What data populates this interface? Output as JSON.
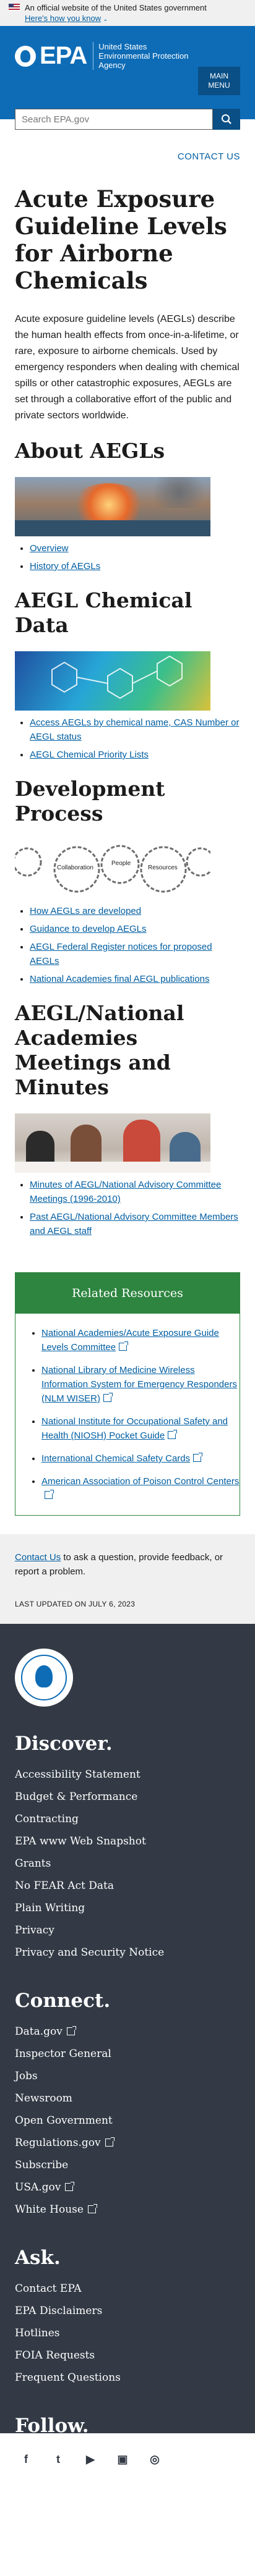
{
  "banner": {
    "official": "An official website of the United States government",
    "how_know": "Here's how you know"
  },
  "header": {
    "logo_text": "EPA",
    "agency": "United States Environmental Protection Agency",
    "menu": "MAIN MENU",
    "search_placeholder": "Search EPA.gov"
  },
  "contact_top": "CONTACT US",
  "page": {
    "title": "Acute Exposure Guideline Levels for Airborne Chemicals",
    "intro": "Acute exposure guideline levels (AEGLs) describe the human health effects from once-in-a-lifetime, or rare, exposure to airborne chemicals. Used by emergency responders when dealing with chemical spills or other catastrophic exposures, AEGLs are set through a collaborative effort of the public and private sectors worldwide."
  },
  "sections": [
    {
      "heading": "About AEGLs",
      "links": [
        "Overview",
        "History of AEGLs"
      ]
    },
    {
      "heading": "AEGL Chemical Data",
      "links": [
        "Access AEGLs by chemical name, CAS Number or AEGL status",
        "AEGL Chemical Priority Lists"
      ]
    },
    {
      "heading": "Development Process",
      "gear_labels": [
        "Collaboration",
        "People",
        "Resources"
      ],
      "links": [
        "How AEGLs are developed",
        "Guidance to develop AEGLs",
        "AEGL Federal Register notices for proposed AEGLs",
        "National Academies final AEGL publications"
      ]
    },
    {
      "heading": "AEGL/National Academies Meetings and Minutes",
      "links": [
        "Minutes of AEGL/National Advisory Committee Meetings (1996-2010)",
        "Past AEGL/National Advisory Committee Members and AEGL staff"
      ]
    }
  ],
  "related": {
    "heading": "Related Resources",
    "links": [
      "National Academies/Acute Exposure Guide Levels Committee",
      "National Library of Medicine Wireless Information System for Emergency Responders (NLM WISER)",
      "National Institute for Occupational Safety and Health (NIOSH) Pocket Guide",
      "International Chemical Safety Cards",
      "American Association of Poison Control Centers"
    ]
  },
  "contact_band": {
    "link": "Contact Us",
    "text": " to ask a question, provide feedback, or report a problem.",
    "updated": "LAST UPDATED ON JULY 6, 2023"
  },
  "footer": {
    "discover": {
      "heading": "Discover.",
      "items": [
        "Accessibility Statement",
        "Budget & Performance",
        "Contracting",
        "EPA www Web Snapshot",
        "Grants",
        "No FEAR Act Data",
        "Plain Writing",
        "Privacy",
        "Privacy and Security Notice"
      ]
    },
    "connect": {
      "heading": "Connect.",
      "items": [
        "Data.gov",
        "Inspector General",
        "Jobs",
        "Newsroom",
        "Open Government",
        "Regulations.gov",
        "Subscribe",
        "USA.gov",
        "White House"
      ]
    },
    "ask": {
      "heading": "Ask.",
      "items": [
        "Contact EPA",
        "EPA Disclaimers",
        "Hotlines",
        "FOIA Requests",
        "Frequent Questions"
      ]
    },
    "follow": {
      "heading": "Follow.",
      "icons": [
        "f",
        "t",
        "▶",
        "▣",
        "◎"
      ]
    }
  }
}
